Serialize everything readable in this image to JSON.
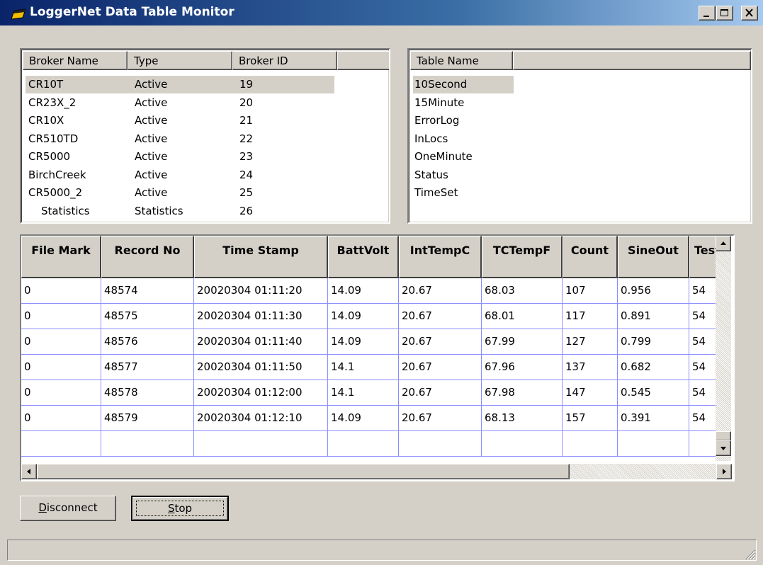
{
  "window": {
    "title": "LoggerNet Data Table Monitor",
    "controls": [
      "minimize",
      "maximize",
      "close"
    ]
  },
  "brokers": {
    "columns": [
      "Broker Name",
      "Type",
      "Broker ID"
    ],
    "rows": [
      {
        "name": "CR10T",
        "type": "Active",
        "id": "19",
        "selected": true
      },
      {
        "name": "CR23X_2",
        "type": "Active",
        "id": "20"
      },
      {
        "name": "CR10X",
        "type": "Active",
        "id": "21"
      },
      {
        "name": "CR510TD",
        "type": "Active",
        "id": "22"
      },
      {
        "name": "CR5000",
        "type": "Active",
        "id": "23"
      },
      {
        "name": "BirchCreek",
        "type": "Active",
        "id": "24"
      },
      {
        "name": "CR5000_2",
        "type": "Active",
        "id": "25"
      },
      {
        "name": "Statistics",
        "type": "Statistics",
        "id": "26"
      }
    ]
  },
  "tables": {
    "column": "Table Name",
    "rows": [
      {
        "name": "10Second",
        "selected": true
      },
      {
        "name": "15Minute"
      },
      {
        "name": "ErrorLog"
      },
      {
        "name": "InLocs"
      },
      {
        "name": "OneMinute"
      },
      {
        "name": "Status"
      },
      {
        "name": "TimeSet"
      }
    ]
  },
  "grid": {
    "columns": [
      "File Mark",
      "Record No",
      "Time Stamp",
      "BattVolt",
      "IntTempC",
      "TCTempF",
      "Count",
      "SineOut",
      "Test"
    ],
    "rows": [
      [
        "0",
        "48574",
        "20020304 01:11:20",
        "14.09",
        "20.67",
        "68.03",
        "107",
        "0.956",
        "54"
      ],
      [
        "0",
        "48575",
        "20020304 01:11:30",
        "14.09",
        "20.67",
        "68.01",
        "117",
        "0.891",
        "54"
      ],
      [
        "0",
        "48576",
        "20020304 01:11:40",
        "14.09",
        "20.67",
        "67.99",
        "127",
        "0.799",
        "54"
      ],
      [
        "0",
        "48577",
        "20020304 01:11:50",
        "14.1",
        "20.67",
        "67.96",
        "137",
        "0.682",
        "54"
      ],
      [
        "0",
        "48578",
        "20020304 01:12:00",
        "14.1",
        "20.67",
        "67.98",
        "147",
        "0.545",
        "54"
      ],
      [
        "0",
        "48579",
        "20020304 01:12:10",
        "14.09",
        "20.67",
        "68.13",
        "157",
        "0.391",
        "54"
      ]
    ],
    "grid_line_color": "#8c8cff"
  },
  "buttons": {
    "disconnect": {
      "pre": "",
      "key": "D",
      "post": "isconnect"
    },
    "stop": {
      "pre": "",
      "key": "S",
      "post": "top"
    }
  },
  "statusbar": {
    "text": ""
  },
  "colors": {
    "title_gradient_start": "#0a246a",
    "title_gradient_end": "#a6caf0",
    "face": "#d4d0c8"
  }
}
